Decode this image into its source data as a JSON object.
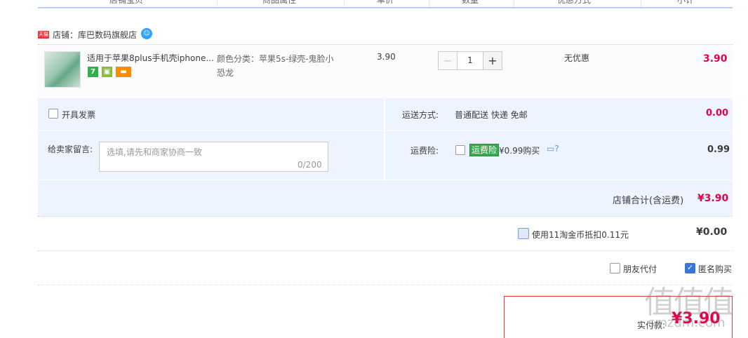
{
  "header": {
    "columns": [
      "店铺宝贝",
      "商品属性",
      "单价",
      "数量",
      "优惠方式",
      "小计"
    ]
  },
  "shop": {
    "logo_text": "天猫",
    "label": "店铺：库巴数码旗舰店",
    "ww_icon": "wangwang-icon"
  },
  "item": {
    "title": "适用于苹果8plus手机壳iphone...",
    "badges": [
      "7",
      "",
      ""
    ],
    "attr_line1": "颜色分类：苹果5s-绿壳-鬼脸小",
    "attr_line2": "恐龙",
    "price": "3.90",
    "qty_minus": "−",
    "qty_value": "1",
    "qty_plus": "+",
    "promo": "无优惠",
    "subtotal": "3.90"
  },
  "options": {
    "invoice_label": "开具发票",
    "shipping_label": "运送方式:",
    "shipping_value": "普通配送 快递 免邮",
    "shipping_fee": "0.00",
    "message_label": "给卖家留言:",
    "message_placeholder": "选填,请先和商家协商一致",
    "message_count": "0/200",
    "insurance_label": "运费险:",
    "insurance_tag": "运费险",
    "insurance_text": "¥0.99购买",
    "insurance_fee": "0.99",
    "shop_total_label": "店铺合计(含运费)",
    "shop_total_value": "¥3.90"
  },
  "coins": {
    "label": "使用11淘金币抵扣0.11元",
    "value": "¥0.00"
  },
  "payment": {
    "friend_pay": "朋友代付",
    "anonymous": "匿名购买"
  },
  "final": {
    "label": "实付款:",
    "value": "¥3.90"
  },
  "watermark": {
    "text": "值值值",
    "site": "smzdm.com"
  }
}
